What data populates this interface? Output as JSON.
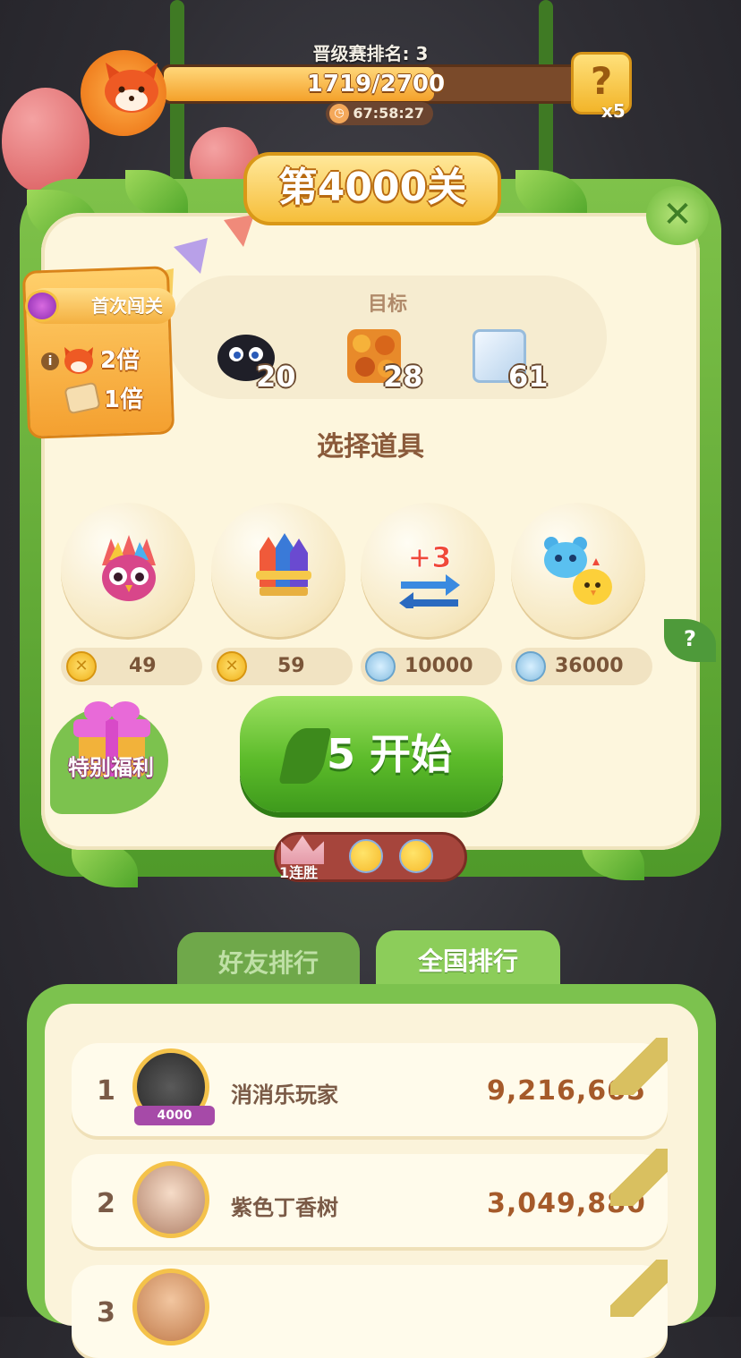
{
  "top": {
    "rank_label": "晋级赛排名: 3",
    "progress_text": "1719/2700",
    "progress_fraction": 0.637,
    "timer": "67:58:27",
    "mystery_count": "x5"
  },
  "level": {
    "title": "第4000关"
  },
  "goals": {
    "title": "目标",
    "items": [
      {
        "icon": "black-fuzzball-icon",
        "count": "20"
      },
      {
        "icon": "autumn-leaves-block-icon",
        "count": "28"
      },
      {
        "icon": "ice-block-icon",
        "count": "61"
      }
    ]
  },
  "first_pass": {
    "label": "首次闯关",
    "fox_multiplier": "2倍",
    "scroll_multiplier": "1倍"
  },
  "items_section": {
    "title": "选择道具",
    "items": [
      {
        "icon": "rainbow-owl-icon",
        "currency": "coin",
        "price": "49"
      },
      {
        "icon": "rocket-bundle-icon",
        "currency": "coin",
        "price": "59"
      },
      {
        "icon": "plus-3-moves-icon",
        "currency": "gem",
        "price": "10000"
      },
      {
        "icon": "bear-chick-swap-icon",
        "currency": "gem",
        "price": "36000"
      }
    ]
  },
  "special_gift": {
    "label": "特别福利"
  },
  "start": {
    "energy": "5",
    "label": "开始"
  },
  "streak": {
    "label": "1连胜"
  },
  "tabs": {
    "friends": "好友排行",
    "national": "全国排行"
  },
  "leaderboard": [
    {
      "rank": "1",
      "name": "消消乐玩家",
      "score": "9,216,665",
      "badge": "4000"
    },
    {
      "rank": "2",
      "name": "紫色丁香树",
      "score": "3,049,880",
      "badge": ""
    },
    {
      "rank": "3",
      "name": "",
      "score": "",
      "badge": ""
    }
  ],
  "colors": {
    "accent_green": "#5cbb2a",
    "board_bg": "#fdf6dd",
    "brown_text": "#7a5a46"
  }
}
